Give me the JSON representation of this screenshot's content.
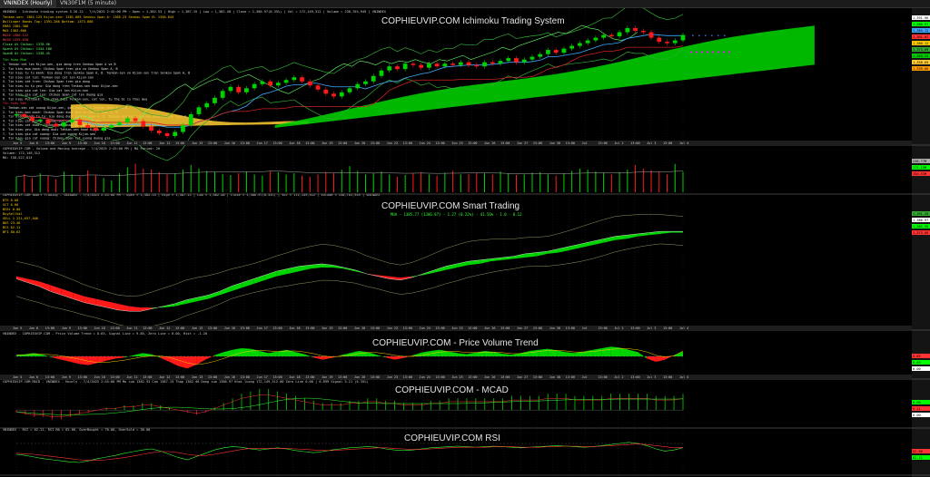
{
  "tabs": [
    {
      "label": "VNINDEX (Hourly)",
      "active": true
    },
    {
      "label": "VN30F1M (5 minute)",
      "active": false
    }
  ],
  "panes": {
    "ichimoku": {
      "watermark": "COPHIEUVIP.COM Ichimoku Trading System",
      "header": "VNINDEX - Ichimoku trading system 5.26.22 - 7/4/2025 2:45:00 PM : Open = 1,382.53 | High = 1,387.15 | Low = 1,382.48 | Close = 1,386.97(0.33%) | Vol = 172,149,312 | Volume = 238,765,949 | VNINDEX",
      "info": [
        "Tenkan-sen: 1384.125  Kijun-sen: 1381.065  Senkou Span A: 1365.23  Senkou Span B: 1358.645",
        "Bollinger Bands Top: 1391.286  Bottom: 1373.086",
        "EMA3 1382.388",
        "MA5 1382.666",
        "MA20 1380.122",
        "MA50 1339.658",
        "Close At Chikou: 1378.96",
        "Spanh At Chikou: 1344.186",
        "SpanB At Chikou: 1338.45"
      ],
      "signals_title_buy": "Tin hieu Mua",
      "signals_buy": [
        "1. Tenkan cat len Kijun-sen, gia dong tren Senkou Span A va B",
        "2. Tin hieu mua manh: Chikou Span tren gia va Senkou Span A, B",
        "3. Tin hieu tu tu manh: Gia dong tren Senkou Span A, B. Tenkan-sen va Kijun-sen tren Senkou Span A, B",
        "4. Tin hieu cat len: Tenkan-sen cat len Kijun-sen",
        "5. Tin hieu cat tren: Chikou Span tren gia dong",
        "6. Tin hieu tu tu yeu: Gia dong tren Tenkan-sen hoac Kijun-sen",
        "7. Tin hieu gia cat len: Gia cat len Kijun-sen",
        "8. Tin hieu gia cat len: Chikou Span cat len duong gia",
        "9. Tin hieu Pullback: Gia cham duoi Tenkan-sen, cat len, tu the bi cu thoi mua"
      ],
      "signals_title_sell": "Tin hieu Ban",
      "signals_sell": [
        "1. Tenkan-sen cat xuong Kijun-sen, gia dong duoi Senkou Span A va B",
        "2. Tin hieu ban manh: Chikou Span duoi gia va Senkou Span A, B",
        "3. Tin hieu khong tu tu: Gia dong duoi Senkou Span A, B. Tenkan-sen va Kijun-sen duoi Senkou Span A, B",
        "4. Tin hieu cat xuong: Tenkan-sen cat xuong Kijun-sen",
        "5. Tin hieu cat duoi: Chikou Span duoi gia dong",
        "6. Tin hieu yeu: Gia dong duoi Tenkan-sen hoac Kijun-sen",
        "7. Tin hieu gia cat xuong: Gia cat xuong Kijun-sen",
        "8. Tin hieu gia cat xuong: Chikou Span cat xuong duong gia",
        "9. Tin hieu Pullback: Gia cham tren Tenkan-sen, cat xuong, tu the bi cu thoi ban"
      ],
      "right_labels": [
        "1,391.96",
        "1,386.97",
        "1,384.12",
        "1,381.07",
        "1,380.12",
        "1,373.09",
        "1,365.23",
        "1,358.65",
        "1,339.66"
      ]
    },
    "volume": {
      "header": "COPHIEUVIP.COM - Volume and Moving Average - 7/4/2025 2:45:00 PM | MA Period: 20",
      "info": [
        "Volume: 172,149,312",
        "MA: 150,527,813"
      ],
      "right_labels": [
        "238.77M",
        "172.15M",
        "150.53M"
      ]
    },
    "smart": {
      "watermark": "COPHIEUVIP.COM Smart Trading",
      "header": "COPHIEUVIP.COM Smart Trading - VNINDEX - 7/4/2025 2:45:00 PM : Open = 1,382.53 | High = 1,387.15 | Low = 1,382.48 | Close = 1,386.97(0.33%) | Vol = 172,149,312 | Volume = 238,765,949 | VNINDEX",
      "subtitle": "MUA - 1385.77 (1386.97) - 1.27 (0.22%) - 41.56% - 1.0 - 0.12",
      "info": [
        "BTS 0.00",
        "SCT 0.00",
        "BCBr 0.00",
        "BuySellVal",
        "SELL 1 221,657,466",
        "BOS 23.46",
        "BCS 62.11",
        "BFI 80.62"
      ],
      "right_labels": [
        "1,391.29",
        "1,386.97",
        "1,382.39",
        "1,373.09"
      ]
    },
    "pvt": {
      "watermark": "COPHIEUVIP.COM - Price Volume Trend",
      "header": "VNINDEX - COPHIEUVIP.COM - Price Volume Trend = 8.65, Signal Line = 9.85, Zero Line = 0.00, Hist = -1.20",
      "right_labels": [
        "9.85",
        "8.65",
        "0.00"
      ]
    },
    "macd": {
      "watermark": "COPHIEUVIP.COM - MCAD",
      "header": "COPHIEUVIP.COM MACD - VNINDEX - Hourly - 7/4/2025 2:45:00 PM  Mo cua 1382.53  Cao 1387.15  Thap 1382.48  Dong cua 1386.97  Khoi luong 172,149,312.00  Zero Line 0.00  |  6.899  Signal 5.21 (6.35%)",
      "right_labels": [
        "6.90",
        "5.21",
        "0.00"
      ]
    },
    "rsi": {
      "watermark": "COPHIEUVIP.COM RSI",
      "header": "VNINDEX - RSI = 62.11, RSI MA = 62.66, OverBought = 70.00, OverSold = 30.00",
      "right_labels": [
        "62.66",
        "62.11"
      ]
    }
  },
  "x_labels": [
    "Jun 5",
    "Jun 6",
    "13:00",
    "Jun 9",
    "13:00",
    "Jun 10",
    "13:00",
    "Jun 11",
    "13:00",
    "Jun 12",
    "13:00",
    "Jun 13",
    "13:00",
    "Jun 16",
    "13:00",
    "Jun 17",
    "13:00",
    "Jun 18",
    "13:00",
    "Jun 19",
    "13:00",
    "Jun 20",
    "13:00",
    "Jun 23",
    "13:00",
    "Jun 24",
    "13:00",
    "Jun 25",
    "13:00",
    "Jun 26",
    "13:00",
    "Jun 27",
    "13:00",
    "Jun 30",
    "13:00",
    "Jul",
    "13:00",
    "Jul 2",
    "13:00",
    "Jul 3",
    "13:00",
    "Jul 4"
  ],
  "colors": {
    "bull": "#00d400",
    "bear": "#ff1a1a",
    "cloud_bull": "#00cc00",
    "cloud_bear": "#ffcc33",
    "tenkan": "#3fa7ff",
    "kijun": "#cc2222",
    "band": "#33aa33",
    "chikou": "#66ff66",
    "axis_bg": "#2a2a2a",
    "grid": "#3a3a3a",
    "magenta": "#ff00ff"
  },
  "chart_data": [
    {
      "type": "candlestick",
      "title": "COPHIEUVIP.COM Ichimoku Trading System",
      "x_unit": "hourly bars (Jun 5 - Jul 4, 2025)",
      "ylim": [
        1310,
        1395
      ],
      "close": [
        1328,
        1326,
        1323,
        1324,
        1321,
        1319,
        1322,
        1324,
        1320,
        1318,
        1316,
        1318,
        1320,
        1322,
        1325,
        1323,
        1319,
        1316,
        1314,
        1312,
        1315,
        1320,
        1328,
        1333,
        1336,
        1340,
        1345,
        1348,
        1344,
        1347,
        1350,
        1352,
        1349,
        1351,
        1353,
        1355,
        1352,
        1349,
        1346,
        1343,
        1341,
        1344,
        1347,
        1350,
        1352,
        1356,
        1360,
        1363,
        1361,
        1365,
        1364,
        1362,
        1365,
        1363,
        1365,
        1364,
        1366,
        1364,
        1363,
        1366,
        1365,
        1367,
        1369,
        1366,
        1368,
        1370,
        1372,
        1375,
        1373,
        1376,
        1378,
        1380,
        1382,
        1384,
        1386,
        1385,
        1388,
        1391,
        1389,
        1388,
        1384,
        1381,
        1380,
        1382,
        1386
      ],
      "series": [
        {
          "name": "Tenkan-sen",
          "last": 1384.125
        },
        {
          "name": "Kijun-sen",
          "last": 1381.065
        },
        {
          "name": "Senkou Span A",
          "last": 1365.23
        },
        {
          "name": "Senkou Span B",
          "last": 1358.645
        },
        {
          "name": "Bollinger Top",
          "last": 1391.286
        },
        {
          "name": "Bollinger Bottom",
          "last": 1373.086
        }
      ]
    },
    {
      "type": "bar",
      "title": "Volume and Moving Average",
      "values": [
        130,
        150,
        120,
        160,
        140,
        110,
        175,
        150,
        135,
        185,
        145,
        120,
        100,
        160,
        210,
        240,
        200,
        190,
        170,
        150,
        160,
        190,
        230,
        200,
        180,
        170,
        155,
        145,
        160,
        175,
        150,
        140,
        180,
        170,
        150,
        160,
        140,
        130,
        150,
        170,
        160,
        190,
        220,
        180,
        150,
        160,
        175,
        150,
        130,
        145,
        160,
        170,
        150,
        140,
        165,
        180,
        150,
        155,
        165,
        160,
        150,
        175,
        160,
        145,
        150,
        165,
        170,
        150,
        140,
        160,
        180,
        200,
        190,
        175,
        165,
        150,
        170,
        190,
        230,
        200,
        185,
        175,
        150,
        239,
        172
      ],
      "unit": "million shares",
      "series": [
        {
          "name": "MA",
          "last": 150.53
        }
      ]
    },
    {
      "type": "area",
      "title": "COPHIEUVIP.COM Smart Trading",
      "x": "same bars as price",
      "ylim": [
        1310,
        1395
      ],
      "series": [
        {
          "name": "Fast",
          "values": [
            1346,
            1343,
            1340,
            1336,
            1333,
            1330,
            1327,
            1325,
            1323,
            1321,
            1320,
            1320,
            1322,
            1324,
            1326,
            1329,
            1331,
            1333,
            1336,
            1340,
            1343,
            1346,
            1349,
            1352,
            1354,
            1356,
            1357,
            1358,
            1357,
            1355,
            1353,
            1350,
            1348,
            1346,
            1345,
            1347,
            1350,
            1353,
            1356,
            1358,
            1360,
            1361,
            1362,
            1363,
            1364,
            1366,
            1367,
            1368,
            1370,
            1372,
            1374,
            1376,
            1378,
            1380,
            1381,
            1382,
            1383,
            1384,
            1384,
            1384
          ]
        },
        {
          "name": "Slow",
          "values": [
            1348,
            1346,
            1344,
            1341,
            1338,
            1335,
            1332,
            1330,
            1328,
            1326,
            1324,
            1323,
            1323,
            1323,
            1324,
            1326,
            1328,
            1330,
            1333,
            1336,
            1339,
            1342,
            1345,
            1348,
            1350,
            1352,
            1354,
            1355,
            1355,
            1354,
            1352,
            1350,
            1349,
            1348,
            1347,
            1348,
            1349,
            1351,
            1353,
            1355,
            1357,
            1358,
            1360,
            1361,
            1362,
            1363,
            1364,
            1366,
            1367,
            1369,
            1371,
            1373,
            1375,
            1377,
            1378,
            1380,
            1381,
            1382,
            1383,
            1383
          ]
        }
      ]
    },
    {
      "type": "area",
      "title": "COPHIEUVIP.COM - Price Volume Trend",
      "ylim": [
        -30,
        30
      ],
      "series": [
        {
          "name": "Price Volume Trend",
          "values": [
            2,
            4,
            6,
            3,
            -2,
            -6,
            -10,
            -14,
            -16,
            -12,
            -8,
            -4,
            -2,
            2,
            6,
            4,
            -3,
            -10,
            -18,
            -22,
            -15,
            -6,
            2,
            8,
            12,
            15,
            14,
            10,
            6,
            9,
            12,
            8,
            4,
            -2,
            -6,
            -3,
            2,
            6,
            10,
            8,
            3,
            -2,
            -6,
            -3,
            2,
            7,
            10,
            12,
            9,
            6,
            4,
            7,
            10,
            8,
            5,
            3,
            6,
            10,
            12,
            14,
            11,
            8,
            6,
            9,
            12,
            15,
            18,
            16,
            12,
            8,
            -4,
            -10,
            -6,
            2,
            8.65
          ]
        },
        {
          "name": "Signal Line",
          "values": [
            3,
            3,
            4,
            4,
            3,
            1,
            -2,
            -5,
            -9,
            -11,
            -11,
            -9,
            -7,
            -4,
            -1,
            1,
            1,
            -2,
            -7,
            -12,
            -15,
            -13,
            -9,
            -4,
            2,
            7,
            10,
            11,
            10,
            9,
            10,
            10,
            8,
            5,
            1,
            -1,
            0,
            2,
            5,
            7,
            7,
            5,
            2,
            0,
            0,
            2,
            5,
            8,
            9,
            9,
            7,
            7,
            8,
            8,
            7,
            5,
            5,
            7,
            9,
            11,
            11,
            10,
            8,
            8,
            9,
            11,
            13,
            14,
            14,
            12,
            8,
            2,
            -1,
            1,
            9.85
          ]
        }
      ]
    },
    {
      "type": "bar",
      "title": "COPHIEUVIP.COM - MCAD",
      "ylim": [
        -8,
        12
      ],
      "values": [
        -1,
        -2,
        -3,
        -3,
        -4,
        -4,
        -3,
        -2,
        -1,
        0,
        1,
        1,
        2,
        2,
        3,
        3,
        2,
        1,
        0,
        -1,
        -2,
        -1,
        1,
        3,
        5,
        7,
        8,
        9,
        9,
        8,
        7,
        6,
        5,
        4,
        3,
        3,
        3,
        4,
        4,
        5,
        5,
        4,
        4,
        3,
        3,
        3,
        4,
        4,
        5,
        5,
        5,
        5,
        5,
        5,
        5,
        6,
        6,
        6,
        6,
        7,
        7,
        7,
        6,
        6,
        6,
        6,
        7,
        7,
        7,
        7,
        7,
        6,
        6,
        6,
        6.9
      ],
      "series": [
        {
          "name": "MACD",
          "last": 6.899
        },
        {
          "name": "Signal",
          "last": 5.21
        }
      ]
    },
    {
      "type": "line",
      "title": "COPHIEUVIP.COM RSI",
      "ylim": [
        20,
        80
      ],
      "series": [
        {
          "name": "RSI",
          "values": [
            50,
            48,
            45,
            42,
            40,
            38,
            36,
            35,
            38,
            42,
            45,
            48,
            52,
            55,
            58,
            60,
            56,
            50,
            44,
            40,
            46,
            52,
            58,
            62,
            64,
            63,
            60,
            58,
            60,
            62,
            60,
            57,
            55,
            53,
            55,
            58,
            60,
            62,
            63,
            64,
            63,
            60,
            58,
            57,
            58,
            60,
            62,
            63,
            64,
            65,
            64,
            63,
            64,
            65,
            64,
            63,
            62,
            63,
            64,
            65,
            66,
            65,
            64,
            63,
            64,
            66,
            68,
            70,
            72,
            70,
            66,
            60,
            56,
            58,
            62.11
          ]
        },
        {
          "name": "RSI MA",
          "values": [
            52,
            51,
            50,
            48,
            46,
            44,
            42,
            40,
            39,
            39,
            40,
            42,
            44,
            47,
            50,
            53,
            55,
            55,
            53,
            50,
            48,
            48,
            50,
            53,
            56,
            59,
            61,
            61,
            61,
            61,
            61,
            60,
            59,
            58,
            57,
            57,
            58,
            59,
            60,
            61,
            62,
            62,
            61,
            60,
            59,
            59,
            60,
            61,
            62,
            63,
            63,
            63,
            63,
            64,
            64,
            64,
            63,
            63,
            63,
            64,
            64,
            65,
            65,
            64,
            64,
            65,
            66,
            67,
            68,
            69,
            68,
            66,
            64,
            62,
            62.66
          ]
        }
      ],
      "overbought": 70,
      "oversold": 30
    }
  ]
}
